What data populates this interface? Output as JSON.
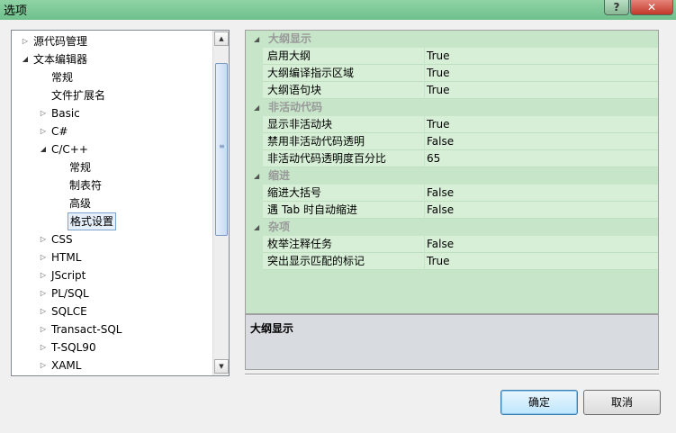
{
  "window": {
    "title": "选项",
    "help_label": "?",
    "close_label": "✕"
  },
  "tree": {
    "nodes": [
      {
        "label": "源代码管理",
        "level": 0,
        "expander": "collapsed"
      },
      {
        "label": "文本编辑器",
        "level": 0,
        "expander": "expanded"
      },
      {
        "label": "常规",
        "level": 1,
        "expander": "none"
      },
      {
        "label": "文件扩展名",
        "level": 1,
        "expander": "none"
      },
      {
        "label": "Basic",
        "level": 1,
        "expander": "collapsed"
      },
      {
        "label": "C#",
        "level": 1,
        "expander": "collapsed"
      },
      {
        "label": "C/C++",
        "level": 1,
        "expander": "expanded"
      },
      {
        "label": "常规",
        "level": 2,
        "expander": "none"
      },
      {
        "label": "制表符",
        "level": 2,
        "expander": "none"
      },
      {
        "label": "高级",
        "level": 2,
        "expander": "none"
      },
      {
        "label": "格式设置",
        "level": 2,
        "expander": "none",
        "selected": true
      },
      {
        "label": "CSS",
        "level": 1,
        "expander": "collapsed"
      },
      {
        "label": "HTML",
        "level": 1,
        "expander": "collapsed"
      },
      {
        "label": "JScript",
        "level": 1,
        "expander": "collapsed"
      },
      {
        "label": "PL/SQL",
        "level": 1,
        "expander": "collapsed"
      },
      {
        "label": "SQLCE",
        "level": 1,
        "expander": "collapsed"
      },
      {
        "label": "Transact-SQL",
        "level": 1,
        "expander": "collapsed"
      },
      {
        "label": "T-SQL90",
        "level": 1,
        "expander": "collapsed"
      },
      {
        "label": "XAML",
        "level": 1,
        "expander": "collapsed"
      }
    ]
  },
  "grid": {
    "categories": [
      {
        "label": "大纲显示",
        "properties": [
          {
            "name": "启用大纲",
            "value": "True"
          },
          {
            "name": "大纲编译指示区域",
            "value": "True"
          },
          {
            "name": "大纲语句块",
            "value": "True"
          }
        ]
      },
      {
        "label": "非活动代码",
        "properties": [
          {
            "name": "显示非活动块",
            "value": "True"
          },
          {
            "name": "禁用非活动代码透明",
            "value": "False"
          },
          {
            "name": "非活动代码透明度百分比",
            "value": "65"
          }
        ]
      },
      {
        "label": "缩进",
        "properties": [
          {
            "name": "缩进大括号",
            "value": "False"
          },
          {
            "name": "遇 Tab 时自动缩进",
            "value": "False"
          }
        ]
      },
      {
        "label": "杂项",
        "properties": [
          {
            "name": "枚举注释任务",
            "value": "False"
          },
          {
            "name": "突出显示匹配的标记",
            "value": "True"
          }
        ]
      }
    ]
  },
  "description": {
    "title": "大纲显示"
  },
  "buttons": {
    "ok": "确定",
    "cancel": "取消"
  }
}
